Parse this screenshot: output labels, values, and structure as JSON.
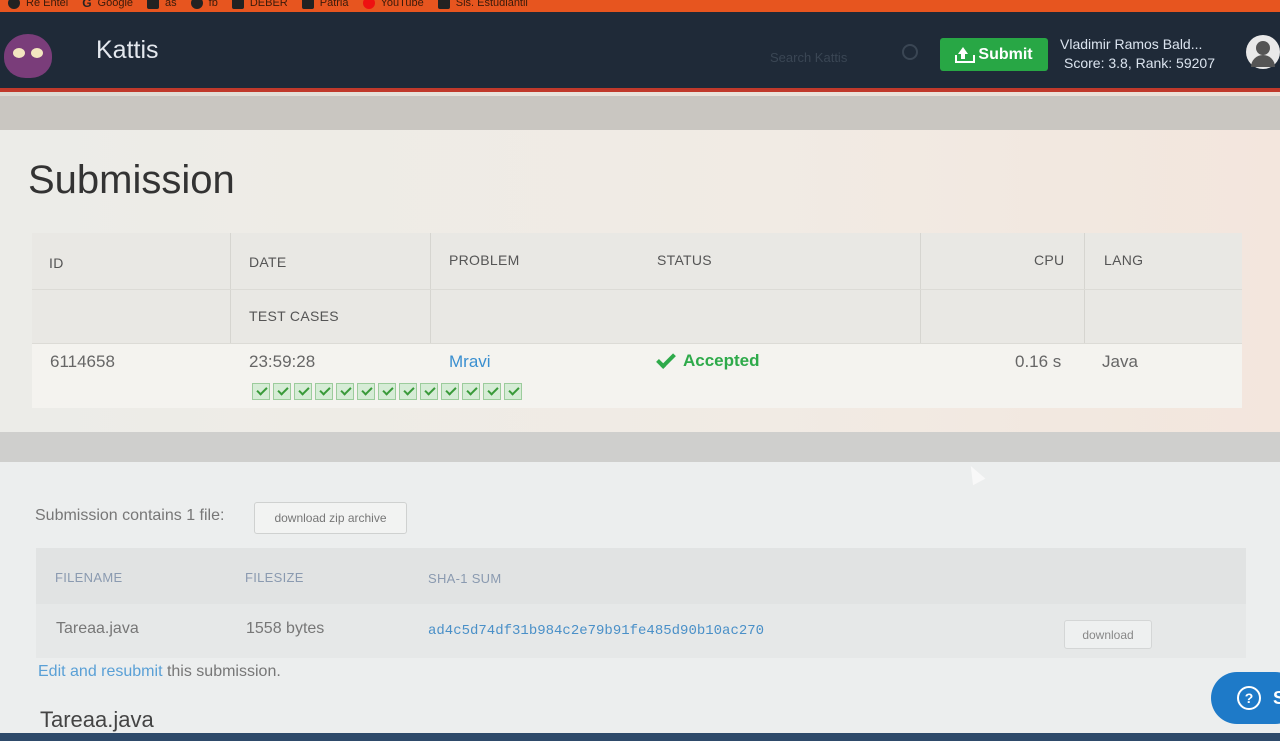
{
  "bookmarks": [
    {
      "label": "Re Entel",
      "icon": "globe-icon"
    },
    {
      "label": "Google",
      "icon": "google-icon"
    },
    {
      "label": "as",
      "icon": "site-icon"
    },
    {
      "label": "fb",
      "icon": "facebook-icon"
    },
    {
      "label": "DEBER",
      "icon": "doc-icon"
    },
    {
      "label": "Patria",
      "icon": "site-icon"
    },
    {
      "label": "YouTube",
      "icon": "youtube-icon"
    },
    {
      "label": "Sis. Estudiantil",
      "icon": "site-icon"
    }
  ],
  "header": {
    "brand": "Kattis",
    "search_placeholder": "Search Kattis",
    "submit_label": "Submit",
    "user_name": "Vladimir Ramos Bald...",
    "user_score": "Score: 3.8, Rank: 59207"
  },
  "submission": {
    "title": "Submission",
    "columns": {
      "id": "ID",
      "date": "DATE",
      "problem": "PROBLEM",
      "status": "STATUS",
      "cpu": "CPU",
      "lang": "LANG",
      "test_cases": "TEST CASES"
    },
    "row": {
      "id": "6114658",
      "date": "23:59:28",
      "problem": "Mravi",
      "status": "Accepted",
      "cpu": "0.16 s",
      "lang": "Java",
      "test_cases_passed": 13
    },
    "accent": "#2eaa4a"
  },
  "files": {
    "contains_label": "Submission contains 1 file:",
    "zip_button": "download zip archive",
    "columns": {
      "filename": "FILENAME",
      "filesize": "FILESIZE",
      "sha1": "SHA-1 SUM"
    },
    "rows": [
      {
        "filename": "Tareaa.java",
        "filesize": "1558 bytes",
        "sha1": "ad4c5d74df31b984c2e79b91fe485d90b10ac270",
        "action": "download"
      }
    ],
    "resubmit_link": "Edit and resubmit",
    "resubmit_rest": " this submission.",
    "file_heading": "Tareaa.java"
  },
  "help": {
    "label": "S"
  }
}
